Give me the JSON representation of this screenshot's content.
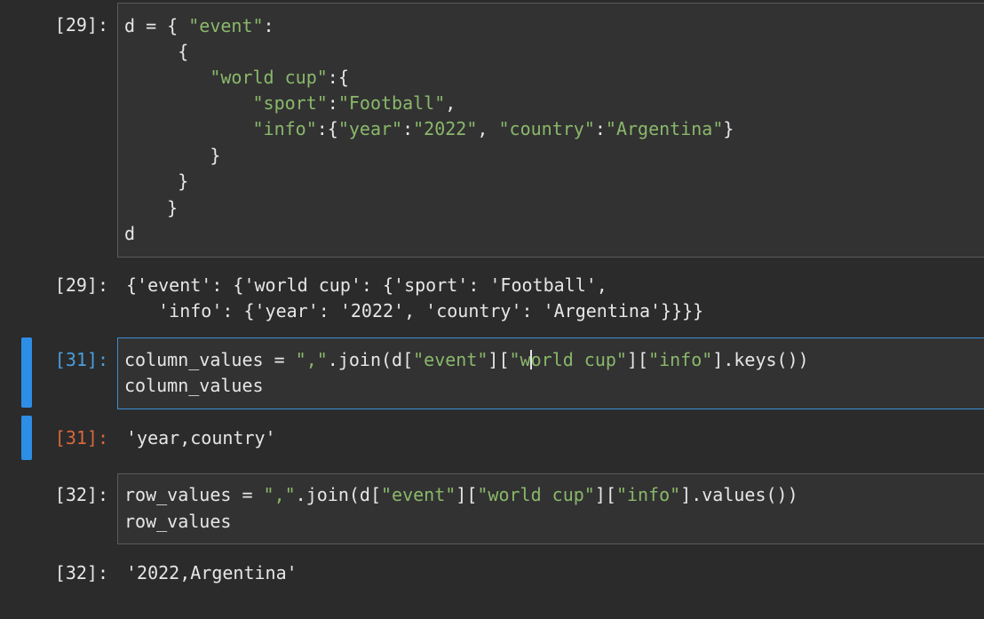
{
  "cells": [
    {
      "prompt_in": "[29]:",
      "code": [
        [
          {
            "t": "d = { "
          },
          {
            "t": "\"event\"",
            "s": 1
          },
          {
            "t": ":"
          }
        ],
        [
          {
            "t": "     {"
          }
        ],
        [
          {
            "t": "        "
          },
          {
            "t": "\"world cup\"",
            "s": 1
          },
          {
            "t": ":{"
          }
        ],
        [
          {
            "t": "            "
          },
          {
            "t": "\"sport\"",
            "s": 1
          },
          {
            "t": ":"
          },
          {
            "t": "\"Football\"",
            "s": 1
          },
          {
            "t": ","
          }
        ],
        [
          {
            "t": "            "
          },
          {
            "t": "\"info\"",
            "s": 1
          },
          {
            "t": ":{"
          },
          {
            "t": "\"year\"",
            "s": 1
          },
          {
            "t": ":"
          },
          {
            "t": "\"2022\"",
            "s": 1
          },
          {
            "t": ", "
          },
          {
            "t": "\"country\"",
            "s": 1
          },
          {
            "t": ":"
          },
          {
            "t": "\"Argentina\"",
            "s": 1
          },
          {
            "t": "}"
          }
        ],
        [
          {
            "t": "        }"
          }
        ],
        [
          {
            "t": "     }"
          }
        ],
        [
          {
            "t": "    }"
          }
        ],
        [
          {
            "t": "d"
          }
        ]
      ],
      "prompt_out": "[29]:",
      "output": [
        "{'event': {'world cup': {'sport': 'Football',",
        "   'info': {'year': '2022', 'country': 'Argentina'}}}}"
      ]
    },
    {
      "prompt_in": "[31]:",
      "code": [
        [
          {
            "t": "column_values = "
          },
          {
            "t": "\",\"",
            "s": 1
          },
          {
            "t": ".join(d["
          },
          {
            "t": "\"event\"",
            "s": 1
          },
          {
            "t": "]["
          },
          {
            "t": "\"w",
            "s": 1
          },
          {
            "cursor": true
          },
          {
            "t": "orld cup\"",
            "s": 1
          },
          {
            "t": "]["
          },
          {
            "t": "\"info\"",
            "s": 1
          },
          {
            "t": "].keys())"
          }
        ],
        [
          {
            "t": "column_values"
          }
        ]
      ],
      "prompt_out": "[31]:",
      "output": [
        "'year,country'"
      ]
    },
    {
      "prompt_in": "[32]:",
      "code": [
        [
          {
            "t": "row_values = "
          },
          {
            "t": "\",\"",
            "s": 1
          },
          {
            "t": ".join(d["
          },
          {
            "t": "\"event\"",
            "s": 1
          },
          {
            "t": "]["
          },
          {
            "t": "\"world cup\"",
            "s": 1
          },
          {
            "t": "]["
          },
          {
            "t": "\"info\"",
            "s": 1
          },
          {
            "t": "].values())"
          }
        ],
        [
          {
            "t": "row_values"
          }
        ]
      ],
      "prompt_out": "[32]:",
      "output": [
        "'2022,Argentina'"
      ]
    }
  ],
  "colors": {
    "background": "#2b2b2b",
    "string": "#8ab86b",
    "active_bar": "#2d8ee6",
    "active_border": "#3b8fd6",
    "prompt_active_in": "#4a9fe0",
    "prompt_active_out": "#d9683c"
  }
}
